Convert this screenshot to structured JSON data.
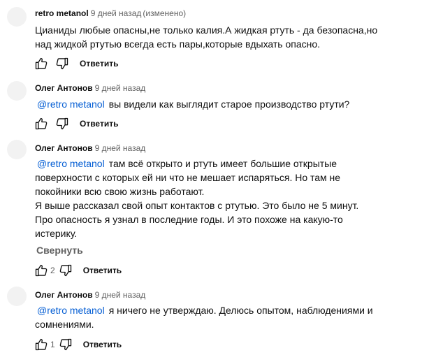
{
  "comments": [
    {
      "author": "retro metanol",
      "time": "9 дней назад",
      "edited": "(изменено)",
      "mention": "",
      "lines": [
        "Цианиды любые опасны,не только калия.А жидкая ртуть - да безопасна,но",
        "над жидкой ртутью всегда есть пары,которые вдыхать опасно."
      ],
      "likes": "",
      "reply_label": "Ответить"
    },
    {
      "author": "Олег Антонов",
      "time": "9 дней назад",
      "edited": "",
      "mention": "@retro metanol",
      "lines": [
        "вы видели как выглядит старое производство ртути?"
      ],
      "likes": "",
      "reply_label": "Ответить"
    },
    {
      "author": "Олег Антонов",
      "time": "9 дней назад",
      "edited": "",
      "mention": "@retro metanol",
      "lines": [
        "там всё открыто и ртуть имеет большие открытые",
        "поверхности с которых ей ни что не мешает испаряться. Но там не",
        "покойники всю свою жизнь работают.",
        "Я выше рассказал свой опыт контактов с ртутью. Это было не 5 минут.",
        "Про опасность я узнал в последние годы. И это похоже на какую-то",
        "истерику."
      ],
      "collapse_label": "Свернуть",
      "likes": "2",
      "reply_label": "Ответить"
    },
    {
      "author": "Олег Антонов",
      "time": "9 дней назад",
      "edited": "",
      "mention": "@retro metanol",
      "lines": [
        "я ничего не утверждаю. Делюсь опытом, наблюдениями и",
        "сомнениями."
      ],
      "likes": "1",
      "reply_label": "Ответить"
    }
  ],
  "icons": {
    "like": "thumb-up-icon",
    "dislike": "thumb-down-icon"
  },
  "colors": {
    "mention": "#065fd4",
    "secondary_text": "#606060",
    "avatar_placeholder": "#f2f2f2"
  }
}
